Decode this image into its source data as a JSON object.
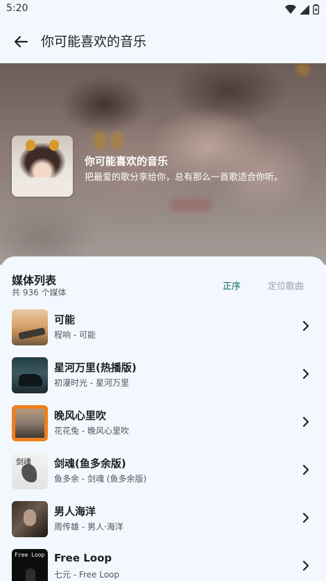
{
  "status_bar": {
    "time": "5:20"
  },
  "app_bar": {
    "title": "你可能喜欢的音乐"
  },
  "playlist": {
    "title": "你可能喜欢的音乐",
    "description": "把最爱的歌分享给你，总有那么一首歌适合你听。"
  },
  "media_list": {
    "title": "媒体列表",
    "count": "共 936 个媒体",
    "order_label": "正序",
    "locate_label": "定位歌曲"
  },
  "songs": [
    {
      "title": "可能",
      "subtitle": "程响 - 可能"
    },
    {
      "title": "星河万里(热播版)",
      "subtitle": "初漫时光 - 星河万里"
    },
    {
      "title": "晚风心里吹",
      "subtitle": "花花兔 - 晚风心里吹"
    },
    {
      "title": "剑魂(鱼多余版)",
      "subtitle": "鱼多余 - 剑魂 (鱼多余版)"
    },
    {
      "title": "男人海洋",
      "subtitle": "周传雄 - 男人·海洋"
    },
    {
      "title": "Free Loop",
      "subtitle": "七元 - Free Loop"
    }
  ],
  "thumb_text": {
    "t4": "剑魂",
    "t6": "Free Loop"
  },
  "colors": {
    "accent": "#0f6b6b",
    "background": "#f2f8fd",
    "muted": "#9aa2a9"
  },
  "icons": {
    "back": "arrow-left-icon",
    "chevron": "chevron-right-icon",
    "wifi": "wifi-icon",
    "signal": "signal-icon",
    "battery": "battery-icon"
  }
}
